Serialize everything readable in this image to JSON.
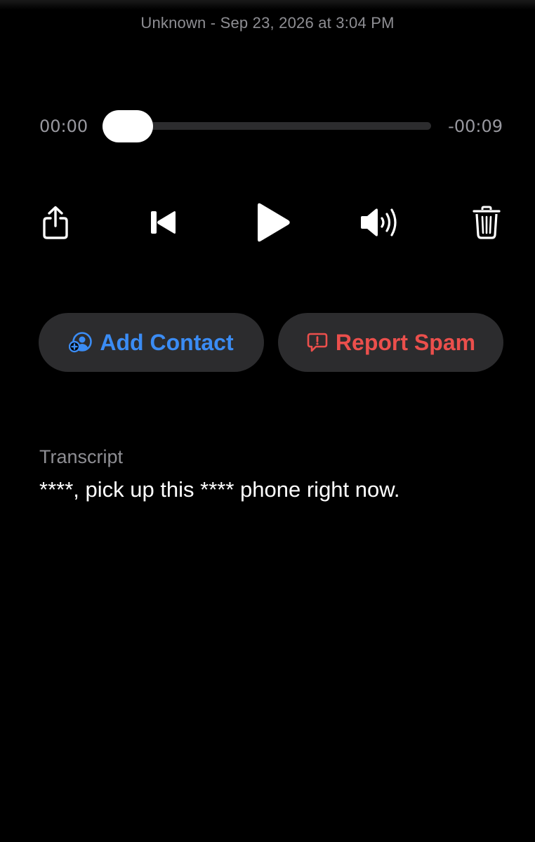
{
  "header": {
    "meta": "Unknown - Sep 23, 2026 at 3:04 PM"
  },
  "player": {
    "elapsed": "00:00",
    "remaining": "-00:09",
    "progress": 0.0
  },
  "controls": {
    "icons": [
      "share-icon",
      "skip-back-icon",
      "play-icon",
      "speaker-icon",
      "trash-icon"
    ]
  },
  "actions": {
    "add_contact_label": "Add Contact",
    "report_spam_label": "Report Spam",
    "add_contact_color": "#3b8cf4",
    "report_spam_color": "#eb4f4c"
  },
  "transcript": {
    "label": "Transcript",
    "text": "****, pick up this **** phone right now."
  }
}
